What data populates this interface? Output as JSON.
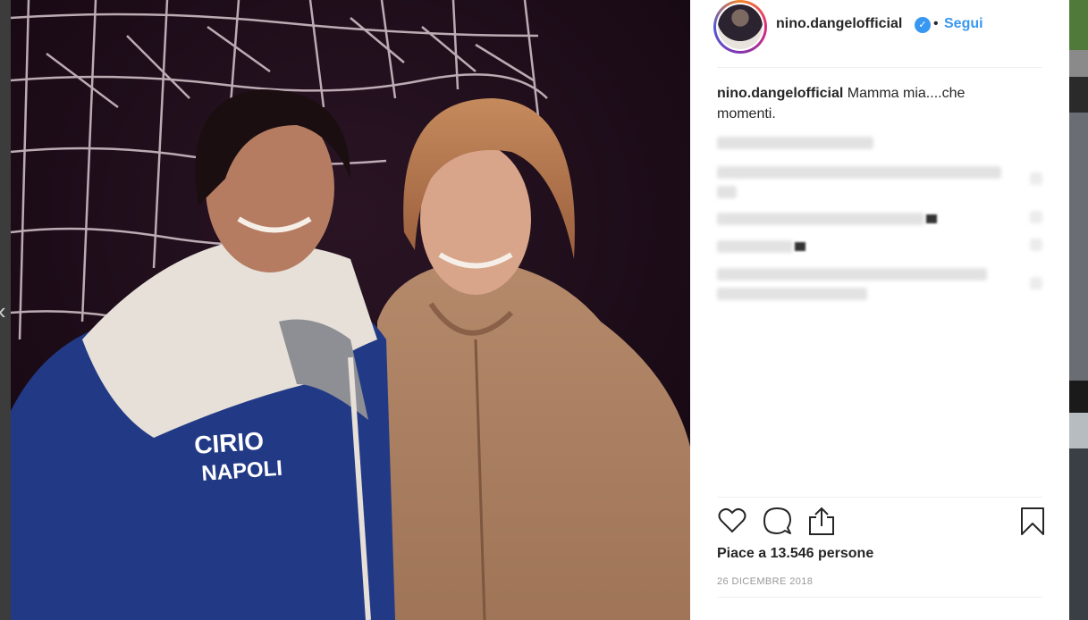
{
  "post": {
    "username": "nino.dangelofficial",
    "verified_badge": "verified-check-icon",
    "separator": "•",
    "follow_label": "Segui",
    "caption_user": "nino.dangelofficial",
    "caption_text": "Mamma mia....che momenti.",
    "likes_text": "Piace a 13.546 persone",
    "date": "26 DICEMBRE 2018",
    "jersey_line1": "CIRIO",
    "jersey_line2": "NAPOLI"
  },
  "actions": {
    "like_icon": "heart-icon",
    "comment_icon": "comment-icon",
    "share_icon": "share-icon",
    "save_icon": "bookmark-icon"
  },
  "colors": {
    "link_blue": "#3897f0",
    "text": "#262626",
    "muted": "#999999"
  }
}
